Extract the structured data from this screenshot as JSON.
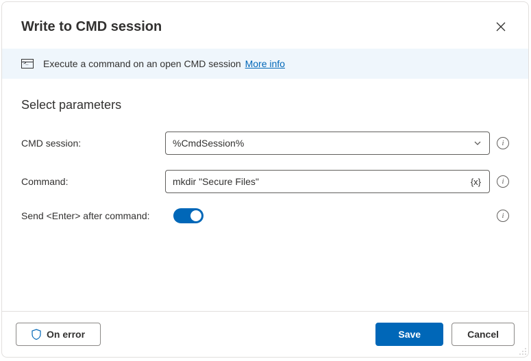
{
  "header": {
    "title": "Write to CMD session"
  },
  "info": {
    "text": "Execute a command on an open CMD session",
    "more_info": "More info"
  },
  "section": {
    "title": "Select parameters"
  },
  "fields": {
    "cmd_session": {
      "label": "CMD session:",
      "value": "%CmdSession%"
    },
    "command": {
      "label": "Command:",
      "value": "mkdir \"Secure Files\"",
      "var_badge": "{x}"
    },
    "send_enter": {
      "label": "Send <Enter> after command:",
      "value": true
    }
  },
  "footer": {
    "on_error": "On error",
    "save": "Save",
    "cancel": "Cancel"
  }
}
